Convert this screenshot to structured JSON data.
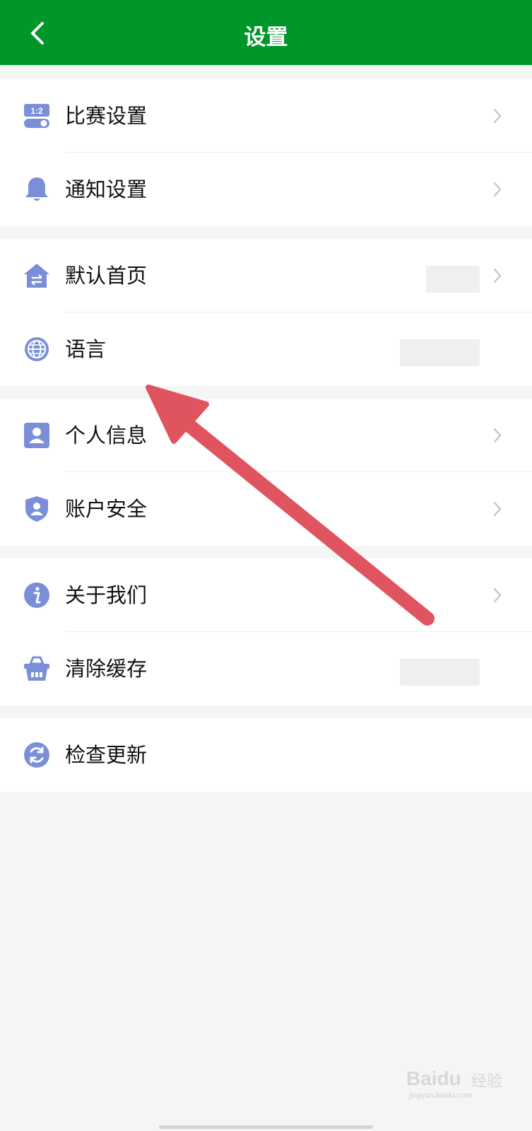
{
  "header": {
    "title": "设置",
    "back_icon": "chevron-left-icon"
  },
  "groups": [
    {
      "items": [
        {
          "label": "比赛设置",
          "icon": "match-score-toggle-icon",
          "has_chevron": true
        },
        {
          "label": "通知设置",
          "icon": "bell-icon",
          "has_chevron": true
        }
      ]
    },
    {
      "items": [
        {
          "label": "默认首页",
          "icon": "home-switch-icon",
          "has_chevron": true,
          "value": "(blurred)"
        },
        {
          "label": "语言",
          "icon": "globe-icon",
          "has_chevron": false,
          "value": "(blurred)"
        }
      ]
    },
    {
      "items": [
        {
          "label": "个人信息",
          "icon": "user-card-icon",
          "has_chevron": true
        },
        {
          "label": "账户安全",
          "icon": "shield-user-icon",
          "has_chevron": true
        }
      ]
    },
    {
      "items": [
        {
          "label": "关于我们",
          "icon": "info-icon",
          "has_chevron": true
        },
        {
          "label": "清除缓存",
          "icon": "basket-icon",
          "has_chevron": false,
          "value": "(blurred)"
        }
      ]
    },
    {
      "items": [
        {
          "label": "检查更新",
          "icon": "refresh-icon",
          "has_chevron": false
        }
      ]
    }
  ],
  "match_icon_text": "1:2",
  "watermark": {
    "brand": "Bai",
    "brand_suffix": "du",
    "brand_cn": "经验",
    "url": "jingyan.baidu.com"
  },
  "colors": {
    "header": "#00962a",
    "icon": "#7b8fd9",
    "annotation_arrow": "#e0545f",
    "background": "#f5f5f5"
  }
}
